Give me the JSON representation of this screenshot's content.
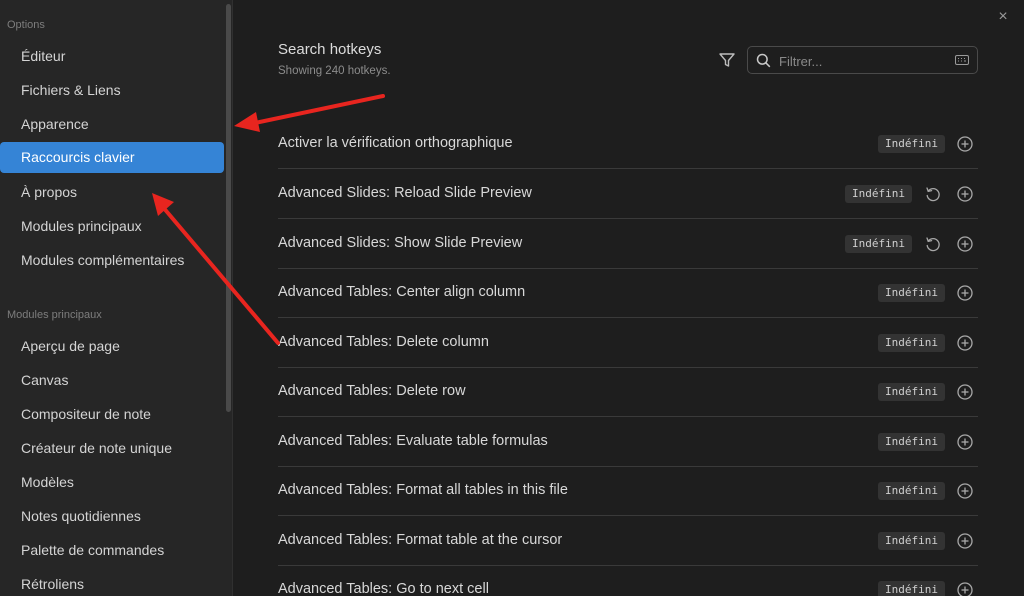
{
  "sidebar": {
    "options_heading": "Options",
    "options_items": [
      {
        "label": "Éditeur",
        "active": false
      },
      {
        "label": "Fichiers & Liens",
        "active": false
      },
      {
        "label": "Apparence",
        "active": false
      },
      {
        "label": "Raccourcis clavier",
        "active": true
      },
      {
        "label": "À propos",
        "active": false
      },
      {
        "label": "Modules principaux",
        "active": false
      },
      {
        "label": "Modules complémentaires",
        "active": false
      }
    ],
    "modules_heading": "Modules principaux",
    "modules_items": [
      {
        "label": "Aperçu de page"
      },
      {
        "label": "Canvas"
      },
      {
        "label": "Compositeur de note"
      },
      {
        "label": "Créateur de note unique"
      },
      {
        "label": "Modèles"
      },
      {
        "label": "Notes quotidiennes"
      },
      {
        "label": "Palette de commandes"
      },
      {
        "label": "Rétroliens"
      }
    ]
  },
  "main": {
    "close_icon": "×",
    "search_title": "Search hotkeys",
    "search_subtitle": "Showing 240 hotkeys.",
    "filter_placeholder": "Filtrer...",
    "hotkeys": [
      {
        "name": "Activer la vérification orthographique",
        "badge": "Indéfini",
        "reset": false
      },
      {
        "name": "Advanced Slides: Reload Slide Preview",
        "badge": "Indéfini",
        "reset": true
      },
      {
        "name": "Advanced Slides: Show Slide Preview",
        "badge": "Indéfini",
        "reset": true
      },
      {
        "name": "Advanced Tables: Center align column",
        "badge": "Indéfini",
        "reset": false
      },
      {
        "name": "Advanced Tables: Delete column",
        "badge": "Indéfini",
        "reset": false
      },
      {
        "name": "Advanced Tables: Delete row",
        "badge": "Indéfini",
        "reset": false
      },
      {
        "name": "Advanced Tables: Evaluate table formulas",
        "badge": "Indéfini",
        "reset": false
      },
      {
        "name": "Advanced Tables: Format all tables in this file",
        "badge": "Indéfini",
        "reset": false
      },
      {
        "name": "Advanced Tables: Format table at the cursor",
        "badge": "Indéfini",
        "reset": false
      },
      {
        "name": "Advanced Tables: Go to next cell",
        "badge": "Indéfini",
        "reset": false
      }
    ]
  },
  "colors": {
    "accent": "#3584d6",
    "annotation_arrow": "#e8251f",
    "background": "#1e1e1e",
    "sidebar_bg": "#262626"
  }
}
